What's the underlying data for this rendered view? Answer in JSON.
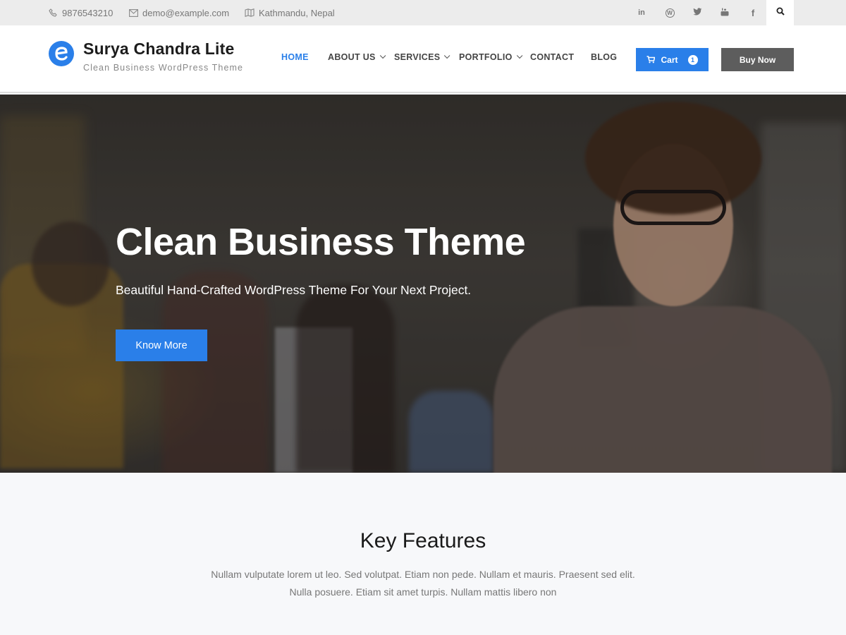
{
  "topbar": {
    "phone": "9876543210",
    "email": "demo@example.com",
    "location": "Kathmandu, Nepal",
    "socials": [
      {
        "name": "linkedin-icon",
        "glyph": "in"
      },
      {
        "name": "wordpress-icon",
        "glyph": "W"
      },
      {
        "name": "twitter-icon",
        "glyph": "t"
      },
      {
        "name": "youtube-icon",
        "glyph": "▶"
      },
      {
        "name": "facebook-icon",
        "glyph": "f"
      }
    ]
  },
  "header": {
    "site_title": "Surya Chandra Lite",
    "tagline": "Clean Business WordPress Theme",
    "logo_letter": "e"
  },
  "nav": {
    "items": [
      {
        "label": "HOME",
        "active": true,
        "dropdown": false
      },
      {
        "label": "ABOUT US",
        "active": false,
        "dropdown": true
      },
      {
        "label": "SERVICES",
        "active": false,
        "dropdown": true
      },
      {
        "label": "PORTFOLIO",
        "active": false,
        "dropdown": true
      },
      {
        "label": "CONTACT",
        "active": false,
        "dropdown": false
      },
      {
        "label": "BLOG",
        "active": false,
        "dropdown": false
      }
    ],
    "cart_label": "Cart",
    "cart_count": "1",
    "buy_label": "Buy Now"
  },
  "hero": {
    "title": "Clean Business Theme",
    "subtitle": "Beautiful Hand-Crafted WordPress Theme For Your Next Project.",
    "button_label": "Know More"
  },
  "features": {
    "title": "Key Features",
    "text_line1": "Nullam vulputate lorem ut leo. Sed volutpat. Etiam non pede. Nullam et mauris. Praesent sed elit.",
    "text_line2": "Nulla posuere. Etiam sit amet turpis. Nullam mattis libero non"
  },
  "colors": {
    "accent": "#2a7fe9",
    "dark_button": "#5d5d5d",
    "topbar_bg": "#ececec"
  }
}
